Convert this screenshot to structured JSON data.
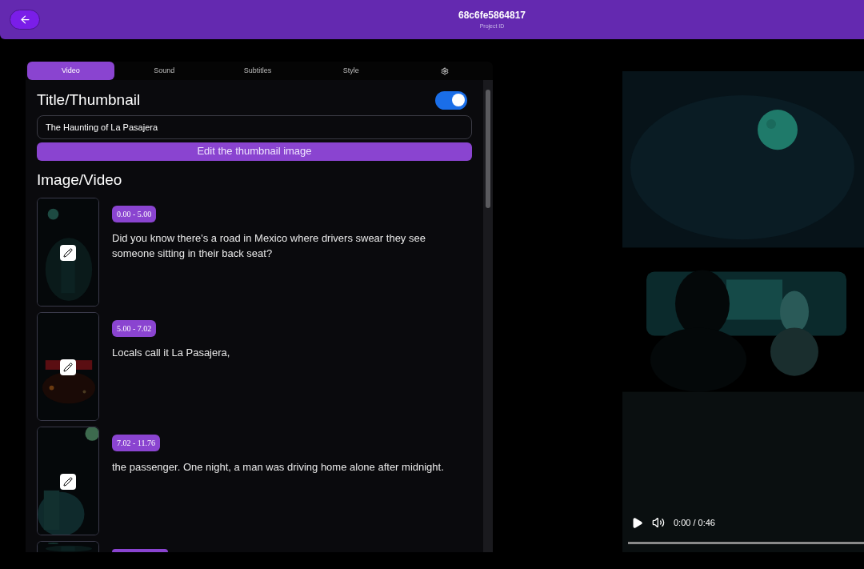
{
  "header": {
    "project_id": "68c6fe5864817",
    "caption": "Project ID"
  },
  "tabs": [
    {
      "label": "Video",
      "kind": "text",
      "selected": true
    },
    {
      "label": "Sound",
      "kind": "text",
      "selected": false
    },
    {
      "label": "Subtitles",
      "kind": "text",
      "selected": false
    },
    {
      "label": "Style",
      "kind": "text",
      "selected": false
    },
    {
      "kind": "settings",
      "selected": false
    }
  ],
  "title_section": {
    "heading": "Title/Thumbnail",
    "on": true,
    "title_value": "The Haunting of La Pasajera",
    "edit_button": "Edit the thumbnail image"
  },
  "media_section": {
    "heading": "Image/Video",
    "items": [
      {
        "kind": "full",
        "time": "0.00 - 5.00",
        "text": "Did you know there's a road in Mexico where drivers swear they see someone sitting in their back seat?"
      },
      {
        "kind": "full",
        "time": "5.00 - 7.02",
        "text": "Locals call it La Pasajera,"
      },
      {
        "kind": "full",
        "time": "7.02 - 11.76",
        "text": "the passenger. One night, a man was driving home alone after midnight."
      },
      {
        "kind": "clipped"
      }
    ]
  },
  "player": {
    "time": "0:00 / 0:46",
    "level": 0
  }
}
